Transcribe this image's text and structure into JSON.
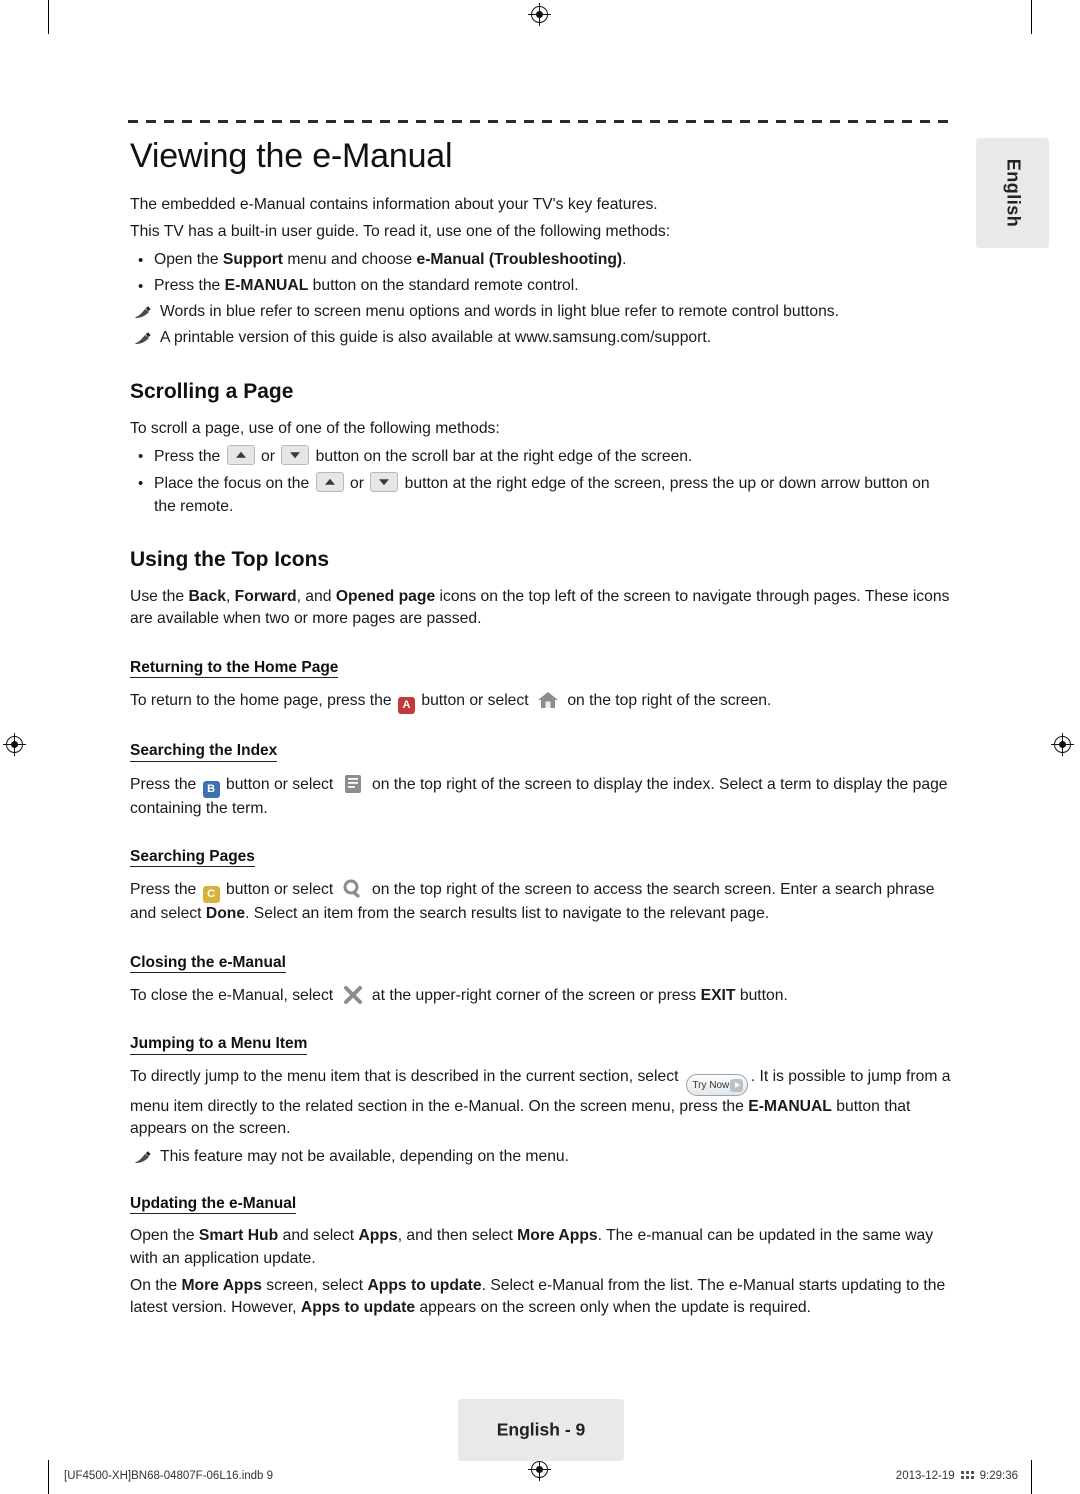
{
  "page": {
    "title": "Viewing the e-Manual",
    "language_tab": "English",
    "footer_page_label": "English - 9",
    "footer_left": "[UF4500-XH]BN68-04807F-06L16.indb   9",
    "footer_right_date": "2013-12-19",
    "footer_right_time": "9:29:36"
  },
  "intro": {
    "line1": "The embedded e-Manual contains information about your TV's key features.",
    "line2": "This TV has a built-in user guide. To read it, use one of the following methods:",
    "bullets": [
      {
        "pre": "Open the ",
        "b1": "Support",
        "mid": " menu and choose ",
        "b2": "e-Manual (Troubleshooting)",
        "post": "."
      },
      {
        "pre": "Press the ",
        "b1": "E-MANUAL",
        "mid": " button on the standard remote control.",
        "b2": "",
        "post": ""
      }
    ],
    "notes": [
      "Words in blue refer to screen menu options and words in light blue refer to remote control buttons.",
      "A printable version of this guide is also available at www.samsung.com/support."
    ]
  },
  "scrolling": {
    "heading": "Scrolling a Page",
    "intro": "To scroll a page, use of one of the following methods:",
    "bullet1_pre": "Press the ",
    "bullet1_or": " or ",
    "bullet1_post": " button on the scroll bar at the right edge of the screen.",
    "bullet2_pre": "Place the focus on the ",
    "bullet2_or": " or ",
    "bullet2_post": " button at the right edge of the screen, press the up or down arrow button on the remote."
  },
  "top_icons": {
    "heading": "Using the Top Icons",
    "intro_pre": "Use the ",
    "intro_b1": "Back",
    "intro_mid1": ", ",
    "intro_b2": "Forward",
    "intro_mid2": ", and ",
    "intro_b3": "Opened page",
    "intro_post": " icons on the top left of the screen to navigate through pages. These icons are available when two or more pages are passed."
  },
  "sections": [
    {
      "heading": "Returning to the Home Page",
      "text_pre": "To return to the home page, press the ",
      "key": "A",
      "text_mid": " button or select ",
      "icon": "home-icon",
      "text_post": " on the top right of the screen."
    },
    {
      "heading": "Searching the Index",
      "text_pre": "Press the ",
      "key": "B",
      "text_mid": " button or select ",
      "icon": "index-icon",
      "text_post": " on the top right of the screen to display the index. Select a term to display the page containing the term."
    },
    {
      "heading": "Searching Pages",
      "text_pre": "Press the ",
      "key": "C",
      "text_mid": " button or select ",
      "icon": "magnifier-icon",
      "text_post": " on the top right of the screen to access the search screen. Enter a search phrase and select ",
      "bold_tail": "Done",
      "text_tail": ". Select an item from the search results list to navigate to the relevant page."
    }
  ],
  "closing": {
    "heading": "Closing the e-Manual",
    "text_pre": "To close the e-Manual, select ",
    "icon": "close-x-icon",
    "text_mid": " at the upper-right corner of the screen or press ",
    "bold": "EXIT",
    "text_post": " button."
  },
  "jumping": {
    "heading": "Jumping to a Menu Item",
    "text_pre": "To directly jump to the menu item that is described in the current section, select ",
    "button_label": "Try Now",
    "text_mid": ". It is possible to jump from a menu item directly to the related section in the e-Manual. On the screen menu, press the ",
    "bold": "E-MANUAL",
    "text_post": " button that appears on the screen.",
    "note": "This feature may not be available, depending on the menu."
  },
  "updating": {
    "heading": "Updating the e-Manual",
    "p1_pre": "Open the ",
    "p1_b1": "Smart Hub",
    "p1_mid1": " and select ",
    "p1_b2": "Apps",
    "p1_mid2": ", and then select ",
    "p1_b3": "More Apps",
    "p1_post": ". The e-manual can be updated in the same way with an application update.",
    "p2_pre": "On the ",
    "p2_b1": "More Apps",
    "p2_mid1": " screen, select ",
    "p2_b2": "Apps to update",
    "p2_mid2": ". Select e-Manual from the list. The e-Manual starts updating to the latest version. However, ",
    "p2_b3": "Apps to update",
    "p2_post": " appears on the screen only when the update is required."
  }
}
